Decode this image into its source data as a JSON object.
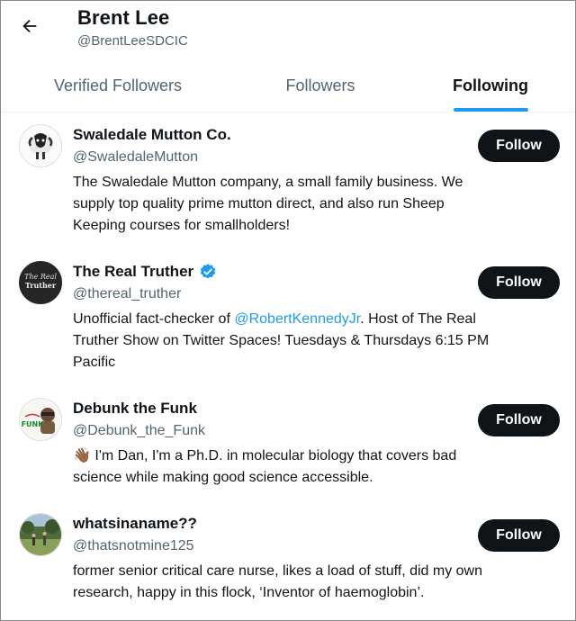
{
  "header": {
    "name": "Brent Lee",
    "handle": "@BrentLeeSDCIC"
  },
  "tabs": [
    {
      "label": "Verified Followers",
      "active": false
    },
    {
      "label": "Followers",
      "active": false
    },
    {
      "label": "Following",
      "active": true
    }
  ],
  "accent_color": "#1d9bf0",
  "users": [
    {
      "name": "Swaledale Mutton Co.",
      "handle": "@SwaledaleMutton",
      "verified": false,
      "bio_lines": [
        "The Swaledale Mutton company, a small family business. We",
        "supply top quality prime mutton direct, and also run Sheep",
        "Keeping courses for smallholders!"
      ],
      "follow_label": "Follow"
    },
    {
      "name": "The Real Truther",
      "handle": "@thereal_truther",
      "verified": true,
      "bio_pre": "Unofficial fact-checker of ",
      "bio_mention": "@RobertKennedyJr",
      "bio_post": ". Host of The Real",
      "bio_lines": [
        "Truther Show on Twitter Spaces! Tuesdays & Thursdays 6:15 PM",
        "Pacific"
      ],
      "avatar_text_1": "The Real",
      "avatar_text_2": "Truther",
      "follow_label": "Follow"
    },
    {
      "name": "Debunk the Funk",
      "handle": "@Debunk_the_Funk",
      "verified": false,
      "bio_emoji": "👋🏾",
      "bio_lines": [
        " I'm Dan, I'm a Ph.D. in molecular biology that covers bad",
        "science while making good science accessible."
      ],
      "avatar_text": "FUNK",
      "follow_label": "Follow"
    },
    {
      "name": "whatsinaname??",
      "handle": "@thatsnotmine125",
      "verified": false,
      "bio_lines": [
        "former senior critical care nurse, likes a load of stuff, did my own",
        "research, happy in this flock, ‘Inventor of haemoglobin’."
      ],
      "follow_label": "Follow"
    }
  ]
}
